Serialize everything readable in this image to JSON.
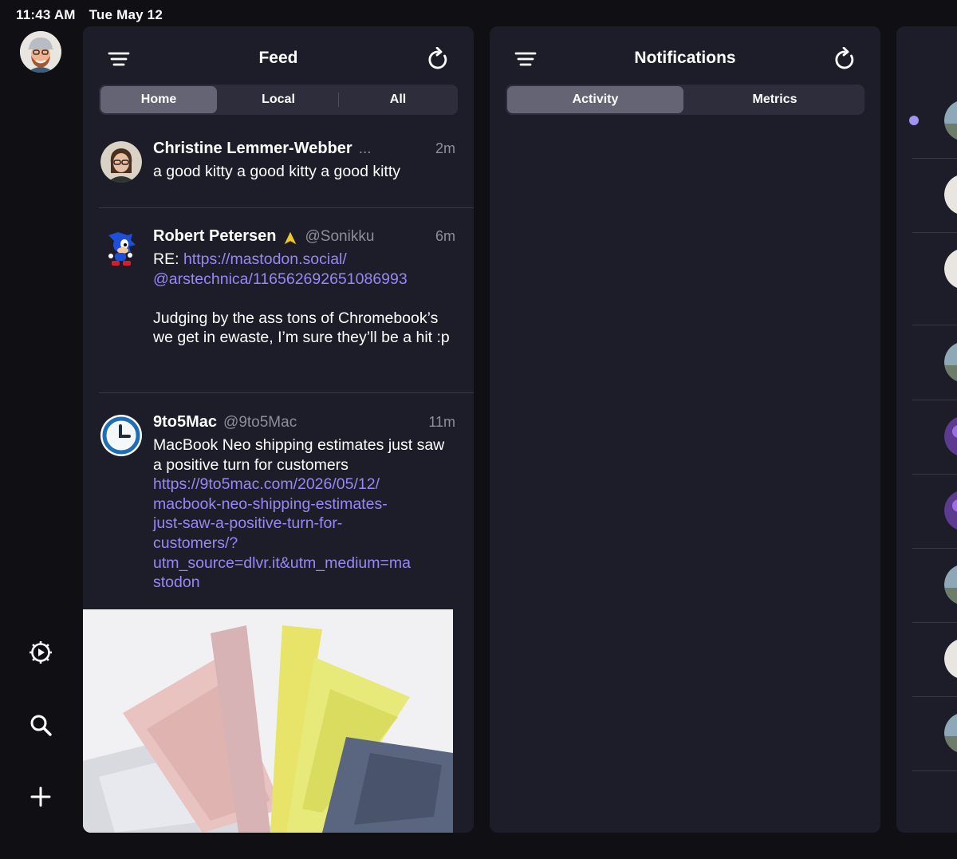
{
  "status": {
    "time": "11:43 AM",
    "date": "Tue May 12"
  },
  "feed": {
    "title": "Feed",
    "tabs": [
      "Home",
      "Local",
      "All"
    ],
    "posts": [
      {
        "name": "Christine Lemmer-Webber",
        "handle": "...",
        "time": "2m",
        "text": "a good kitty a good kitty a good kitty"
      },
      {
        "name": "Robert Petersen",
        "handle": "@Sonikku",
        "time": "6m",
        "reply_prefix": "RE: ",
        "link_line1": "https://mastodon.social/",
        "link_line2": "@arstechnica/116562692651086993",
        "text": "Judging by the ass tons of Chromebook’s we get in ewaste, I’m sure they’ll be a hit :p"
      },
      {
        "name": "9to5Mac",
        "handle": "@9to5Mac",
        "time": "11m",
        "text": "MacBook Neo shipping estimates just saw a positive turn for customers",
        "link_lines": [
          "https://9to5mac.com/2026/05/12/",
          "macbook-neo-shipping-estimates-",
          "just-saw-a-positive-turn-for-",
          "customers/?",
          "utm_source=dlvr.it&utm_medium=ma",
          "stodon"
        ]
      }
    ]
  },
  "notifications": {
    "title": "Notifications",
    "tabs": [
      "Activity",
      "Metrics"
    ]
  },
  "colors": {
    "background": "#0f0f14",
    "column": "#1d1d29",
    "accent_link": "#9a86f5",
    "segment_active": "#646475"
  }
}
